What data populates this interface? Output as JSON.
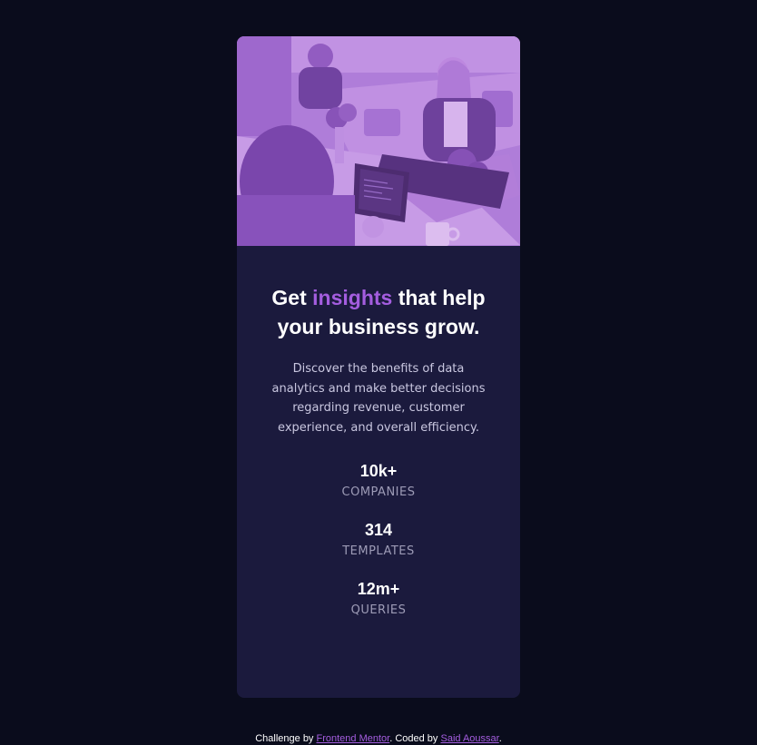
{
  "colors": {
    "page_background": "#0a0c1c",
    "card_background": "#1b1a3d",
    "accent": "#a45ddf",
    "image_tint": "#a46fd3"
  },
  "hero": {
    "alt": "Photo of people working at a table with laptops",
    "icon": "office-photo"
  },
  "headline": {
    "part1": "Get ",
    "accent": "insights",
    "part2": " that help your business grow."
  },
  "description": "Discover the benefits of data analytics and make better decisions regarding revenue, customer experience, and overall efficiency.",
  "stats": [
    {
      "value": "10k+",
      "label": "Companies"
    },
    {
      "value": "314",
      "label": "Templates"
    },
    {
      "value": "12m+",
      "label": "Queries"
    }
  ],
  "footer": {
    "prefix": "Challenge by ",
    "link1": "Frontend Mentor",
    "middle": ". Coded by ",
    "link2": "Said Aoussar",
    "suffix": "."
  }
}
